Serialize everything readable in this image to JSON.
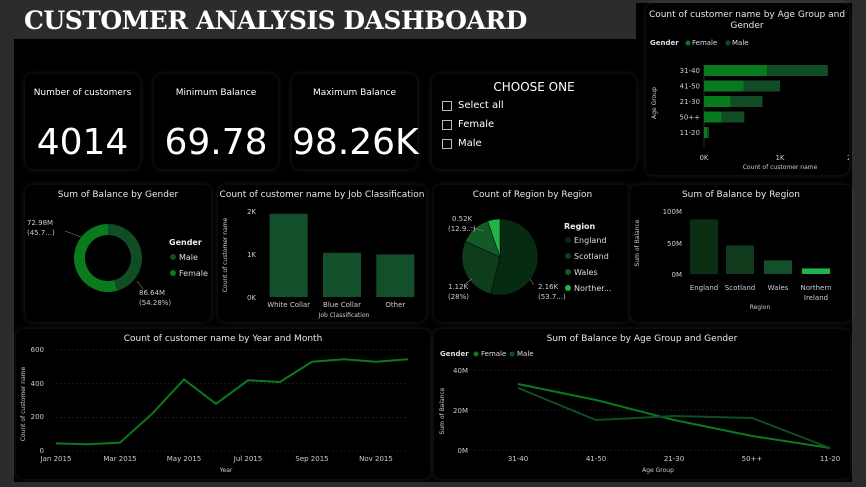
{
  "dashboard": {
    "title": "CUSTOMER ANALYSIS DASHBOARD",
    "colors": {
      "female": "#0a7a1f",
      "male": "#114d24",
      "bar": "#134f2a",
      "accent": "#22b44a"
    }
  },
  "kpis": [
    {
      "label": "Number of customers",
      "value": "4014"
    },
    {
      "label": "Minimum Balance",
      "value": "69.78"
    },
    {
      "label": "Maximum Balance",
      "value": "98.26K"
    }
  ],
  "slicer": {
    "title": "CHOOSE ONE",
    "options": [
      "Select all",
      "Female",
      "Male"
    ]
  },
  "age_gender_bar": {
    "title": "Count of customer name by Age Group and Gender",
    "legend_title": "Gender",
    "legend": [
      "Female",
      "Male"
    ],
    "ylabel": "Age Group",
    "xlabel": "Count of customer name",
    "xticks": [
      "0K",
      "1K",
      "2K"
    ]
  },
  "gender_donut": {
    "title": "Sum of Balance by Gender",
    "legend_title": "Gender",
    "legend": [
      "Male",
      "Female"
    ],
    "label_male_1": "72.98M",
    "label_male_2": "(45.7...)",
    "label_female_1": "86.64M",
    "label_female_2": "(54.28%)"
  },
  "job_bar": {
    "title": "Count of customer name by Job Classification",
    "ylabel": "Count of customer name",
    "xlabel": "Job Classification",
    "yticks": [
      "2K",
      "1K",
      "0K"
    ]
  },
  "region_pie": {
    "title": "Count of Region by Region",
    "legend_title": "Region",
    "legend": [
      "England",
      "Scotland",
      "Wales",
      "Norther..."
    ],
    "label_a1": "0.52K",
    "label_a2": "(12.9...)",
    "label_b1": "1.12K",
    "label_b2": "(28%)",
    "label_c1": "2.16K",
    "label_c2": "(53.7...)"
  },
  "region_bar": {
    "title": "Sum of Balance by Region",
    "ylabel": "Sum of Balance",
    "xlabel": "Region",
    "yticks": [
      "100M",
      "50M",
      "0M"
    ],
    "cat_england": "England",
    "cat_scotland": "Scotland",
    "cat_wales": "Wales",
    "cat_northern_1": "Northern",
    "cat_northern_2": "Ireland"
  },
  "year_month_line": {
    "title": "Count of customer name by Year and Month",
    "ylabel": "Count of customer name",
    "xlabel": "Year",
    "yticks": [
      "600",
      "400",
      "200",
      "0"
    ],
    "xticks": [
      "Jan 2015",
      "Mar 2015",
      "May 2015",
      "Jul 2015",
      "Sep 2015",
      "Nov 2015"
    ]
  },
  "age_gender_line": {
    "title": "Sum of Balance by Age Group and Gender",
    "legend_title": "Gender",
    "legend": [
      "Female",
      "Male"
    ],
    "ylabel": "Sum of Balance",
    "xlabel": "Age Group",
    "yticks": [
      "40M",
      "20M",
      "0M"
    ]
  },
  "chart_data": [
    {
      "type": "bar",
      "orientation": "horizontal",
      "title": "Count of customer name by Age Group and Gender",
      "categories": [
        "31-40",
        "41-50",
        "21-30",
        "50++",
        "11-20"
      ],
      "series": [
        {
          "name": "Female",
          "values": [
            830,
            520,
            350,
            230,
            40
          ]
        },
        {
          "name": "Male",
          "values": [
            800,
            480,
            420,
            300,
            25
          ]
        }
      ],
      "xlabel": "Count of customer name",
      "ylabel": "Age Group",
      "xlim": [
        0,
        2000
      ],
      "stacked": true
    },
    {
      "type": "pie",
      "title": "Sum of Balance by Gender",
      "labels": [
        "Male",
        "Female"
      ],
      "values": [
        72.98,
        86.64
      ],
      "donut": true
    },
    {
      "type": "bar",
      "title": "Count of customer name by Job Classification",
      "categories": [
        "White Collar",
        "Blue Collar",
        "Other"
      ],
      "values": [
        1960,
        1040,
        1000
      ],
      "xlabel": "Job Classification",
      "ylabel": "Count of customer name",
      "ylim": [
        0,
        2000
      ]
    },
    {
      "type": "pie",
      "title": "Count of Region by Region",
      "labels": [
        "England",
        "Scotland",
        "Wales",
        "Northern Ireland"
      ],
      "values": [
        2160,
        1120,
        520,
        210
      ]
    },
    {
      "type": "bar",
      "title": "Sum of Balance by Region",
      "categories": [
        "England",
        "Scotland",
        "Wales",
        "Northern Ireland"
      ],
      "values": [
        88,
        46,
        22,
        9
      ],
      "xlabel": "Region",
      "ylabel": "Sum of Balance",
      "ylim": [
        0,
        100
      ]
    },
    {
      "type": "line",
      "title": "Count of customer name by Year and Month",
      "x": [
        "Jan 2015",
        "Feb 2015",
        "Mar 2015",
        "Apr 2015",
        "May 2015",
        "Jun 2015",
        "Jul 2015",
        "Aug 2015",
        "Sep 2015",
        "Oct 2015",
        "Nov 2015",
        "Dec 2015"
      ],
      "values": [
        45,
        40,
        50,
        220,
        425,
        280,
        420,
        410,
        530,
        545,
        530,
        545
      ],
      "xlabel": "Year",
      "ylabel": "Count of customer name",
      "ylim": [
        0,
        600
      ]
    },
    {
      "type": "line",
      "title": "Sum of Balance by Age Group and Gender",
      "x": [
        "31-40",
        "41-50",
        "21-30",
        "50++",
        "11-20"
      ],
      "series": [
        {
          "name": "Female",
          "values": [
            33,
            25,
            15,
            7,
            1
          ]
        },
        {
          "name": "Male",
          "values": [
            31,
            15,
            17,
            16,
            1
          ]
        }
      ],
      "xlabel": "Age Group",
      "ylabel": "Sum of Balance",
      "ylim": [
        0,
        40
      ]
    }
  ]
}
